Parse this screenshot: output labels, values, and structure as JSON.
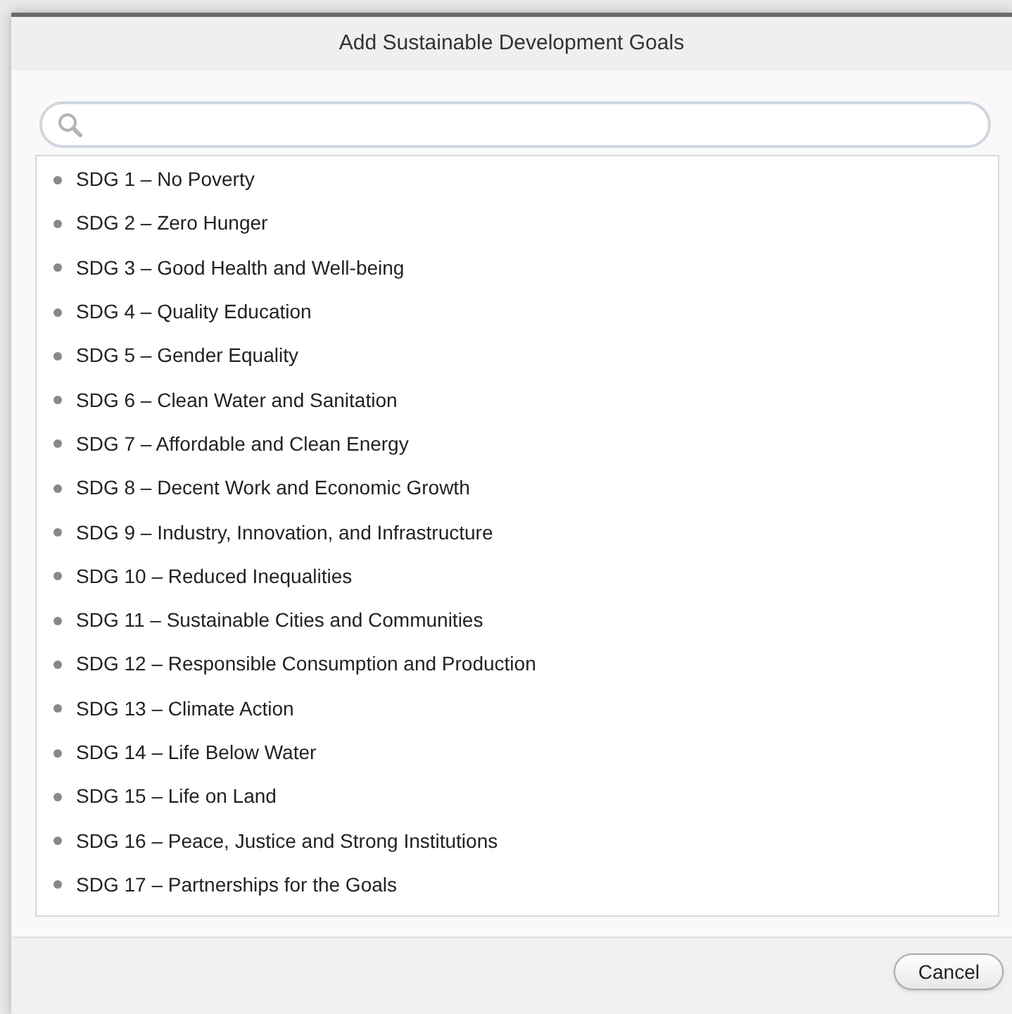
{
  "dialog": {
    "title": "Add Sustainable Development Goals"
  },
  "goals": [
    "SDG 1 – No Poverty",
    "SDG 2 – Zero Hunger",
    "SDG 3 – Good Health and Well-being",
    "SDG 4 – Quality Education",
    "SDG 5 – Gender Equality",
    "SDG 6 – Clean Water and Sanitation",
    "SDG 7 – Affordable and Clean Energy",
    "SDG 8 – Decent Work and Economic Growth",
    "SDG 9 – Industry, Innovation, and Infrastructure",
    "SDG 10 – Reduced Inequalities",
    "SDG 11 – Sustainable Cities and Communities",
    "SDG 12 – Responsible Consumption and Production",
    "SDG 13 – Climate Action",
    "SDG 14 – Life Below Water",
    "SDG 15 – Life on Land",
    "SDG 16 – Peace, Justice and Strong Institutions",
    "SDG 17 – Partnerships for the Goals"
  ],
  "buttons": [
    "Cancel"
  ]
}
